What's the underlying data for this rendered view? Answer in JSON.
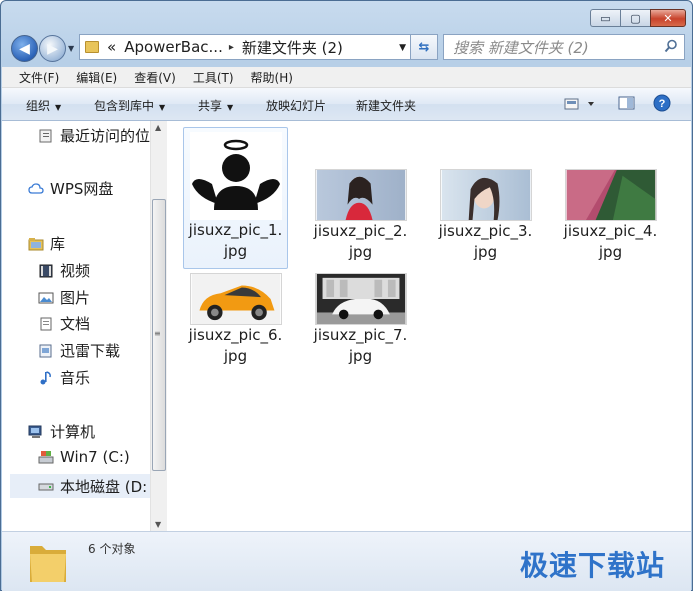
{
  "window": {
    "caption_buttons": {
      "minimize": "▭",
      "maximize": "▢",
      "close": "✕"
    }
  },
  "nav": {
    "address_segments": [
      "«",
      "ApowerBac...",
      "▸",
      "新建文件夹 (2)"
    ],
    "search_placeholder": "搜索 新建文件夹 (2)"
  },
  "menubar": [
    "文件(F)",
    "编辑(E)",
    "查看(V)",
    "工具(T)",
    "帮助(H)"
  ],
  "commandbar": {
    "organize": "组织",
    "include_in_library": "包含到库中",
    "share": "共享",
    "slideshow": "放映幻灯片",
    "new_folder": "新建文件夹"
  },
  "navpane": {
    "items": [
      {
        "label": "最近访问的位",
        "icon": "recent-places-icon"
      },
      {
        "label": "WPS网盘",
        "icon": "cloud-icon"
      },
      {
        "label": "库",
        "icon": "library-icon"
      },
      {
        "label": "视频",
        "icon": "video-icon"
      },
      {
        "label": "图片",
        "icon": "pictures-icon"
      },
      {
        "label": "文档",
        "icon": "documents-icon"
      },
      {
        "label": "迅雷下载",
        "icon": "download-icon"
      },
      {
        "label": "音乐",
        "icon": "music-icon"
      },
      {
        "label": "计算机",
        "icon": "computer-icon"
      },
      {
        "label": "Win7 (C:)",
        "icon": "drive-c-icon"
      },
      {
        "label": "本地磁盘 (D:",
        "icon": "drive-d-icon"
      }
    ]
  },
  "files": [
    {
      "name_line1": "jisuxz_pic_1.",
      "name_line2": "jpg",
      "thumb": "angel-avatar"
    },
    {
      "name_line1": "jisuxz_pic_2.",
      "name_line2": "jpg",
      "thumb": "photo-woman-red"
    },
    {
      "name_line1": "jisuxz_pic_3.",
      "name_line2": "jpg",
      "thumb": "photo-woman-closeup"
    },
    {
      "name_line1": "jisuxz_pic_4.",
      "name_line2": "jpg",
      "thumb": "photo-pink-green-field"
    },
    {
      "name_line1": "jisuxz_pic_6.",
      "name_line2": "jpg",
      "thumb": "photo-orange-suv"
    },
    {
      "name_line1": "jisuxz_pic_7.",
      "name_line2": "jpg",
      "thumb": "photo-white-sportscar"
    }
  ],
  "details": {
    "count_text": "6 个对象",
    "watermark": "极速下载站"
  },
  "colors": {
    "accent": "#2f73c9",
    "selection": "#a9c6ea"
  }
}
